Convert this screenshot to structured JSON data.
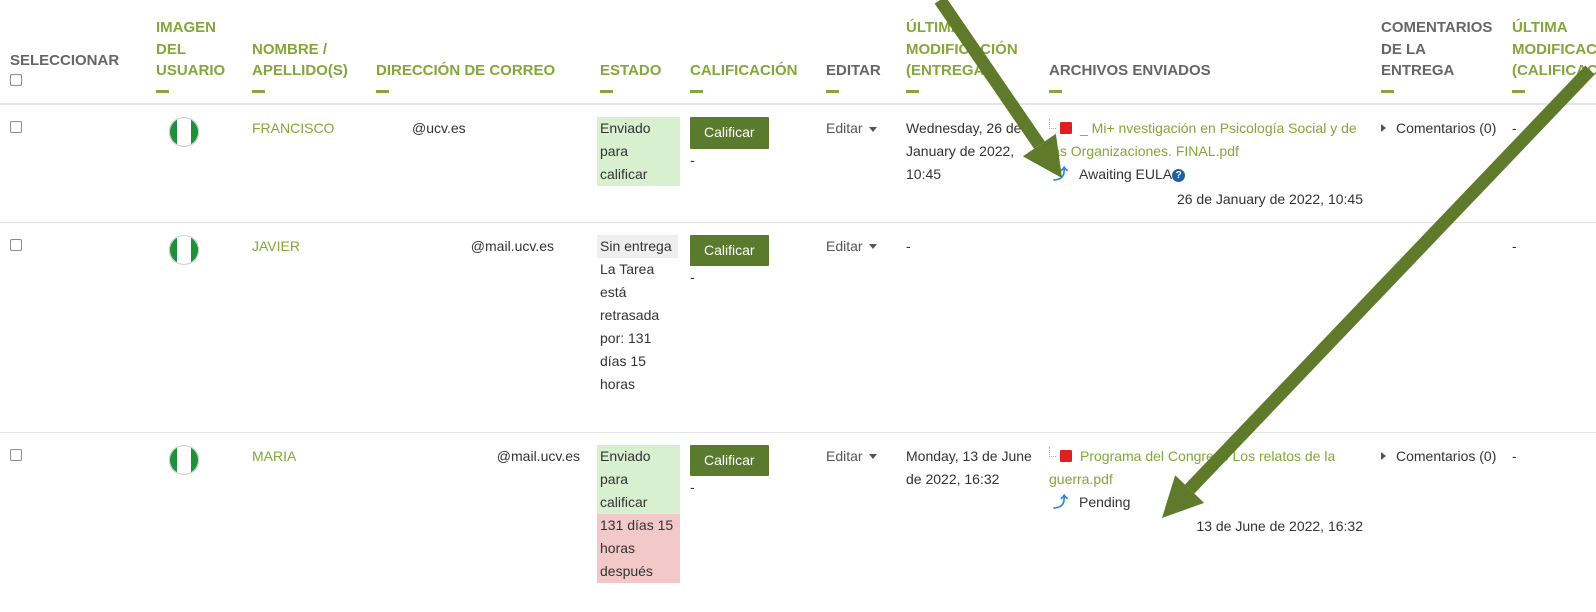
{
  "headers": {
    "select": "SELECCIONAR",
    "image": "IMAGEN DEL USUARIO",
    "name": "NOMBRE / APELLIDO(S)",
    "email": "DIRECCIÓN DE CORREO",
    "status": "ESTADO",
    "grade": "CALIFICACIÓN",
    "edit": "EDITAR",
    "last_modified": "ÚLTIMA MODIFICACIÓN (ENTREGA)",
    "files": "ARCHIVOS ENVIADOS",
    "comments": "COMENTARIOS DE LA ENTREGA",
    "last_modified_grade": "ÚLTIMA MODIFICACIÓN (CALIFICACIÓN)"
  },
  "rows": [
    {
      "name": "FRANCISCO",
      "email": "@ucv.es",
      "status": [
        "Enviado para calificar"
      ],
      "grade_button": "Calificar",
      "grade": "-",
      "edit": "Editar",
      "modified": "Wednesday, 26 de January de 2022, 10:45",
      "file_name": "_ Mi+ nvestigación en Psicología Social y de las Organizaciones. FINAL.pdf",
      "plagiarism_status": "Awaiting EULA",
      "file_date": "26 de January de 2022, 10:45",
      "comments": "Comentarios (0)",
      "grade_modified": "-"
    },
    {
      "name": "JAVIER",
      "email": "@mail.ucv.es",
      "status": [
        "Sin entrega",
        "La Tarea está retrasada por: 131 días 15 horas"
      ],
      "grade_button": "Calificar",
      "grade": "-",
      "edit": "Editar",
      "modified": "-",
      "grade_modified": "-"
    },
    {
      "name": "MARIA",
      "email": "@mail.ucv.es",
      "status": [
        "Enviado para calificar",
        "131 días 15 horas después"
      ],
      "grade_button": "Calificar",
      "grade": "-",
      "edit": "Editar",
      "modified": "Monday, 13 de June de 2022, 16:32",
      "file_name": "Programa del Congreso Los relatos de la guerra.pdf",
      "plagiarism_status": "Pending",
      "file_date": "13 de June de 2022, 16:32",
      "comments": "Comentarios (0)",
      "grade_modified": "-"
    }
  ],
  "annotation_arrow_color": "#5f7a2a"
}
